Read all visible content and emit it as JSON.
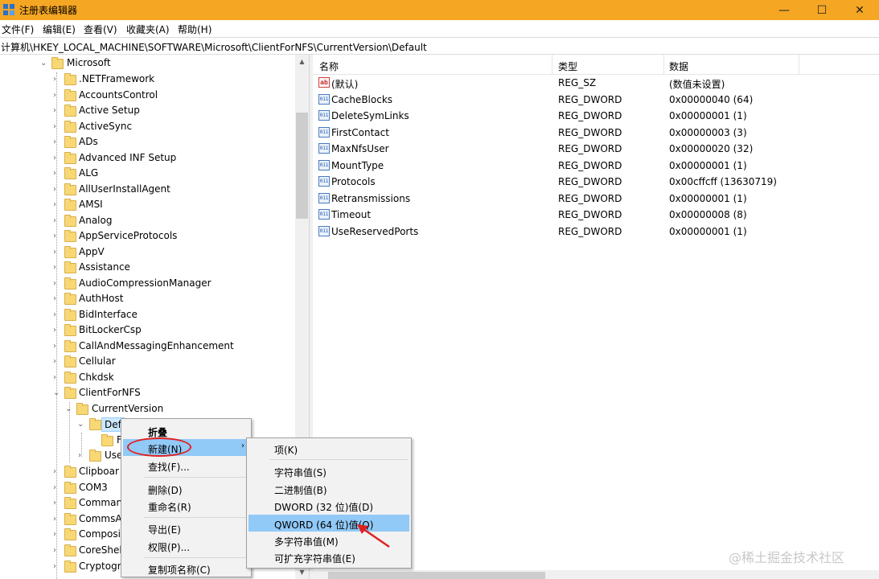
{
  "window": {
    "title": "注册表编辑器",
    "controls": {
      "minimize": "—",
      "maximize": "☐",
      "close": "✕"
    }
  },
  "menubar": [
    "文件(F)",
    "编辑(E)",
    "查看(V)",
    "收藏夹(A)",
    "帮助(H)"
  ],
  "address": "计算机\\HKEY_LOCAL_MACHINE\\SOFTWARE\\Microsoft\\ClientForNFS\\CurrentVersion\\Default",
  "tree": {
    "root": "Microsoft",
    "items": [
      ".NETFramework",
      "AccountsControl",
      "Active Setup",
      "ActiveSync",
      "ADs",
      "Advanced INF Setup",
      "ALG",
      "AllUserInstallAgent",
      "AMSI",
      "Analog",
      "AppServiceProtocols",
      "AppV",
      "Assistance",
      "AudioCompressionManager",
      "AuthHost",
      "BidInterface",
      "BitLockerCsp",
      "CallAndMessagingEnhancement",
      "Cellular",
      "Chkdsk",
      "ClientForNFS"
    ],
    "current_version": "CurrentVersion",
    "default_key": "Def",
    "default_child": "F",
    "user_key": "Use",
    "after_items": [
      "Clipboar",
      "COM3",
      "Comman",
      "CommsA",
      "Composi",
      "CoreShel",
      "Cryptogr"
    ]
  },
  "list": {
    "columns": [
      "名称",
      "类型",
      "数据"
    ],
    "rows": [
      {
        "icon": "ab",
        "name": "(默认)",
        "type": "REG_SZ",
        "data": "(数值未设置)"
      },
      {
        "icon": "011",
        "name": "CacheBlocks",
        "type": "REG_DWORD",
        "data": "0x00000040 (64)"
      },
      {
        "icon": "011",
        "name": "DeleteSymLinks",
        "type": "REG_DWORD",
        "data": "0x00000001 (1)"
      },
      {
        "icon": "011",
        "name": "FirstContact",
        "type": "REG_DWORD",
        "data": "0x00000003 (3)"
      },
      {
        "icon": "011",
        "name": "MaxNfsUser",
        "type": "REG_DWORD",
        "data": "0x00000020 (32)"
      },
      {
        "icon": "011",
        "name": "MountType",
        "type": "REG_DWORD",
        "data": "0x00000001 (1)"
      },
      {
        "icon": "011",
        "name": "Protocols",
        "type": "REG_DWORD",
        "data": "0x00cffcff (13630719)"
      },
      {
        "icon": "011",
        "name": "Retransmissions",
        "type": "REG_DWORD",
        "data": "0x00000001 (1)"
      },
      {
        "icon": "011",
        "name": "Timeout",
        "type": "REG_DWORD",
        "data": "0x00000008 (8)"
      },
      {
        "icon": "011",
        "name": "UseReservedPorts",
        "type": "REG_DWORD",
        "data": "0x00000001 (1)"
      }
    ]
  },
  "context_menu": {
    "items": [
      "折叠",
      "新建(N)",
      "查找(F)...",
      "删除(D)",
      "重命名(R)",
      "导出(E)",
      "权限(P)...",
      "复制项名称(C)"
    ]
  },
  "submenu": {
    "items": [
      "项(K)",
      "字符串值(S)",
      "二进制值(B)",
      "DWORD (32 位)值(D)",
      "QWORD (64 位)值(Q)",
      "多字符串值(M)",
      "可扩充字符串值(E)"
    ]
  },
  "watermark": "@稀土掘金技术社区",
  "colors": {
    "titlebar": "#f5a623",
    "highlight": "#91c9f7",
    "annotation": "#e02020"
  }
}
